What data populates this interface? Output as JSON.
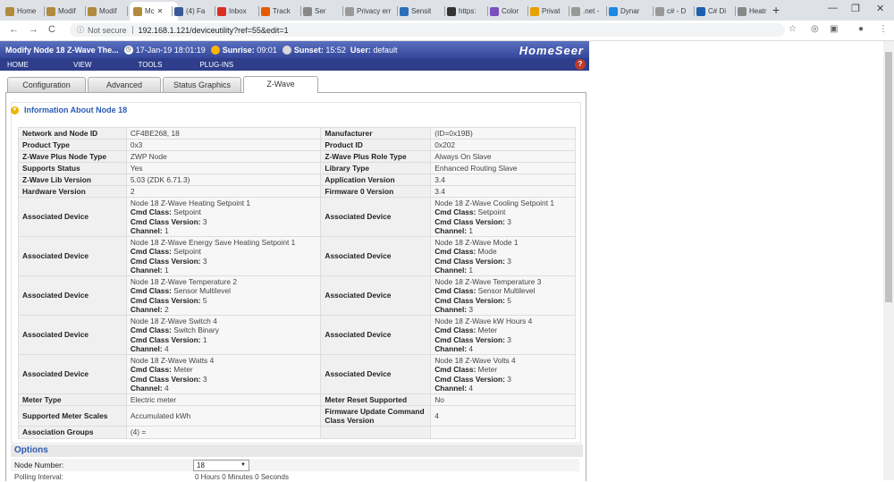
{
  "browser": {
    "tabs": [
      {
        "label": "Home",
        "color": "#b08a3e"
      },
      {
        "label": "Modif",
        "color": "#b08a3e"
      },
      {
        "label": "Modif",
        "color": "#b08a3e"
      },
      {
        "label": "Mc",
        "color": "#b08a3e",
        "active": true
      },
      {
        "label": "(4) Fa",
        "color": "#3b5998"
      },
      {
        "label": "Inbox",
        "color": "#d93025"
      },
      {
        "label": "Track",
        "color": "#e65c00"
      },
      {
        "label": "Ser",
        "color": "#888"
      },
      {
        "label": "Privacy err",
        "color": "#999"
      },
      {
        "label": "Sensit",
        "color": "#2b6fb8"
      },
      {
        "label": "https:",
        "color": "#333"
      },
      {
        "label": "Color",
        "color": "#7a4fbf"
      },
      {
        "label": "Privat",
        "color": "#e6a000"
      },
      {
        "label": ".net -",
        "color": "#999"
      },
      {
        "label": "Dynar",
        "color": "#1e88e5"
      },
      {
        "label": "c# - D",
        "color": "#999"
      },
      {
        "label": "C# Di",
        "color": "#1e60b0"
      },
      {
        "label": "Heatr",
        "color": "#888"
      }
    ],
    "new_tab": "+",
    "minimize": "—",
    "restore": "❐",
    "close": "✕",
    "nav_back": "←",
    "nav_forward": "→",
    "nav_reload": "C",
    "security": "Not secure",
    "url": "192.168.1.121/deviceutility?ref=55&edit=1",
    "star": "☆",
    "menu": "⋮"
  },
  "header": {
    "title": "Modify Node 18 Z-Wave The...",
    "datetime": "17-Jan-19 18:01:19",
    "sunrise_label": "Sunrise:",
    "sunrise": "09:01",
    "sunset_label": "Sunset:",
    "sunset": "15:52",
    "user_label": "User:",
    "user": "default",
    "logo": "HomeSeer",
    "help": "?"
  },
  "menu": [
    "HOME",
    "VIEW",
    "TOOLS",
    "PLUG-INS"
  ],
  "page_tabs": [
    "Configuration",
    "Advanced",
    "Status Graphics",
    "Z-Wave"
  ],
  "info_header": "Information About Node 18",
  "rows": [
    {
      "k1": "Network and Node ID",
      "v1": "CF4BE268, 18",
      "k2": "Manufacturer",
      "v2": "(ID=0x19B)"
    },
    {
      "k1": "Product Type",
      "v1": "0x3",
      "k2": "Product ID",
      "v2": "0x202"
    },
    {
      "k1": "Z-Wave Plus Node Type",
      "v1": "ZWP Node",
      "k2": "Z-Wave Plus Role Type",
      "v2": "Always On Slave"
    },
    {
      "k1": "Supports Status",
      "v1": "Yes",
      "k2": "Library Type",
      "v2": "Enhanced Routing Slave"
    },
    {
      "k1": "Z-Wave Lib Version",
      "v1": "5.03 (ZDK 6.71.3)",
      "k2": "Application Version",
      "v2": "3.4"
    },
    {
      "k1": "Hardware Version",
      "v1": "2",
      "k2": "Firmware 0 Version",
      "v2": "3.4"
    }
  ],
  "assoc_label": "Associated Device",
  "cmd_class_label": "Cmd Class:",
  "cmd_ver_label": "Cmd Class Version:",
  "channel_label": "Channel:",
  "assoc": [
    [
      {
        "name": "Node 18 Z-Wave Heating Setpoint 1",
        "cls": "Setpoint",
        "ver": "3",
        "ch": "1"
      },
      {
        "name": "Node 18 Z-Wave Cooling Setpoint 1",
        "cls": "Setpoint",
        "ver": "3",
        "ch": "1"
      }
    ],
    [
      {
        "name": "Node 18 Z-Wave Energy Save Heating Setpoint 1",
        "cls": "Setpoint",
        "ver": "3",
        "ch": "1"
      },
      {
        "name": "Node 18 Z-Wave Mode 1",
        "cls": "Mode",
        "ver": "3",
        "ch": "1"
      }
    ],
    [
      {
        "name": "Node 18 Z-Wave Temperature 2",
        "cls": "Sensor Multilevel",
        "ver": "5",
        "ch": "2"
      },
      {
        "name": "Node 18 Z-Wave Temperature 3",
        "cls": "Sensor Multilevel",
        "ver": "5",
        "ch": "3"
      }
    ],
    [
      {
        "name": "Node 18 Z-Wave Switch 4",
        "cls": "Switch Binary",
        "ver": "1",
        "ch": "4"
      },
      {
        "name": "Node 18 Z-Wave kW Hours 4",
        "cls": "Meter",
        "ver": "3",
        "ch": "4"
      }
    ],
    [
      {
        "name": "Node 18 Z-Wave Watts 4",
        "cls": "Meter",
        "ver": "3",
        "ch": "4"
      },
      {
        "name": "Node 18 Z-Wave Volts 4",
        "cls": "Meter",
        "ver": "3",
        "ch": "4"
      }
    ]
  ],
  "tail_rows": [
    {
      "k1": "Meter Type",
      "v1": "Electric meter",
      "k2": "Meter Reset Supported",
      "v2": "No"
    },
    {
      "k1": "Supported Meter Scales",
      "v1": "Accumulated kWh",
      "k2": "Firmware Update Command Class Version",
      "v2": "4"
    },
    {
      "k1": "Association Groups",
      "v1": "(4) =",
      "k2": "",
      "v2": ""
    }
  ],
  "options": {
    "title": "Options",
    "node_number_label": "Node Number:",
    "node_number_value": "18",
    "polling_label": "Polling Interval:",
    "polling_value": "0 Hours 0 Minutes 0 Seconds"
  }
}
